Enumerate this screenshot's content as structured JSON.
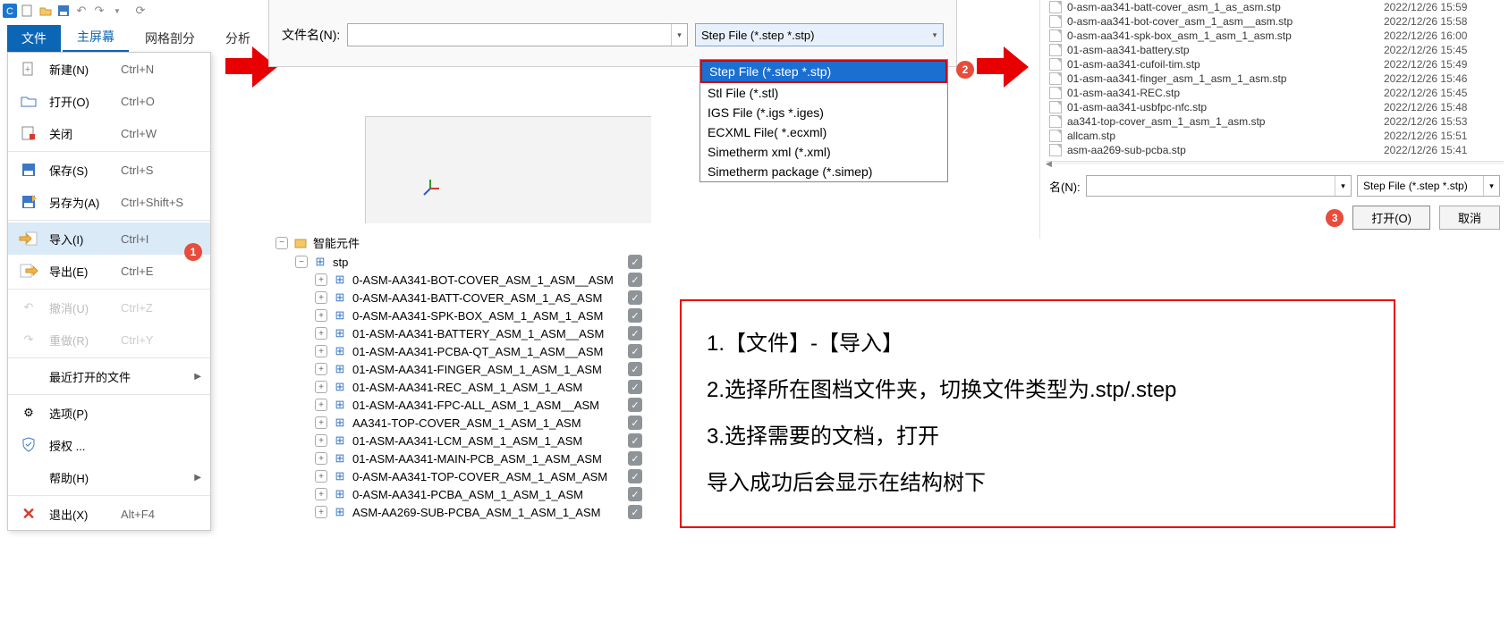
{
  "ribbon": {
    "file": "文件",
    "main": "主屏幕",
    "mesh": "网格剖分",
    "analysis": "分析"
  },
  "menu": {
    "new": {
      "label": "新建(N)",
      "shortcut": "Ctrl+N"
    },
    "open": {
      "label": "打开(O)",
      "shortcut": "Ctrl+O"
    },
    "close": {
      "label": "关闭",
      "shortcut": "Ctrl+W"
    },
    "save": {
      "label": "保存(S)",
      "shortcut": "Ctrl+S"
    },
    "saveas": {
      "label": "另存为(A)",
      "shortcut": "Ctrl+Shift+S"
    },
    "import": {
      "label": "导入(I)",
      "shortcut": "Ctrl+I"
    },
    "export": {
      "label": "导出(E)",
      "shortcut": "Ctrl+E"
    },
    "undo": {
      "label": "撤消(U)",
      "shortcut": "Ctrl+Z"
    },
    "redo": {
      "label": "重做(R)",
      "shortcut": "Ctrl+Y"
    },
    "recent": {
      "label": "最近打开的文件"
    },
    "options": {
      "label": "选项(P)"
    },
    "license": {
      "label": "授权 ..."
    },
    "help": {
      "label": "帮助(H)"
    },
    "exit": {
      "label": "退出(X)",
      "shortcut": "Alt+F4"
    }
  },
  "callouts": {
    "c1": "1",
    "c2": "2",
    "c3": "3"
  },
  "openDialog": {
    "filenameLabel": "文件名(N):",
    "typeSelected": "Step File (*.step *.stp)",
    "options": {
      "o0": "Step File (*.step *.stp)",
      "o1": "Stl File (*.stl)",
      "o2": "IGS File (*.igs *.iges)",
      "o3": "ECXML File( *.ecxml)",
      "o4": "Simetherm xml (*.xml)",
      "o5": "Simetherm package (*.simep)"
    }
  },
  "tree": {
    "root": "智能元件",
    "stp": "stp",
    "items": {
      "i0": "0-ASM-AA341-BOT-COVER_ASM_1_ASM__ASM",
      "i1": "0-ASM-AA341-BATT-COVER_ASM_1_AS_ASM",
      "i2": "0-ASM-AA341-SPK-BOX_ASM_1_ASM_1_ASM",
      "i3": "01-ASM-AA341-BATTERY_ASM_1_ASM__ASM",
      "i4": "01-ASM-AA341-PCBA-QT_ASM_1_ASM__ASM",
      "i5": "01-ASM-AA341-FINGER_ASM_1_ASM_1_ASM",
      "i6": "01-ASM-AA341-REC_ASM_1_ASM_1_ASM",
      "i7": "01-ASM-AA341-FPC-ALL_ASM_1_ASM__ASM",
      "i8": "AA341-TOP-COVER_ASM_1_ASM_1_ASM",
      "i9": "01-ASM-AA341-LCM_ASM_1_ASM_1_ASM",
      "i10": "01-ASM-AA341-MAIN-PCB_ASM_1_ASM_ASM",
      "i11": "0-ASM-AA341-TOP-COVER_ASM_1_ASM_ASM",
      "i12": "0-ASM-AA341-PCBA_ASM_1_ASM_1_ASM",
      "i13": "ASM-AA269-SUB-PCBA_ASM_1_ASM_1_ASM"
    }
  },
  "browser": {
    "files": {
      "f0": {
        "name": "0-asm-aa341-batt-cover_asm_1_as_asm.stp",
        "date": "2022/12/26 15:59"
      },
      "f1": {
        "name": "0-asm-aa341-bot-cover_asm_1_asm__asm.stp",
        "date": "2022/12/26 15:58"
      },
      "f2": {
        "name": "0-asm-aa341-spk-box_asm_1_asm_1_asm.stp",
        "date": "2022/12/26 16:00"
      },
      "f3": {
        "name": "01-asm-aa341-battery.stp",
        "date": "2022/12/26 15:45"
      },
      "f4": {
        "name": "01-asm-aa341-cufoil-tim.stp",
        "date": "2022/12/26 15:49"
      },
      "f5": {
        "name": "01-asm-aa341-finger_asm_1_asm_1_asm.stp",
        "date": "2022/12/26 15:46"
      },
      "f6": {
        "name": "01-asm-aa341-REC.stp",
        "date": "2022/12/26 15:45"
      },
      "f7": {
        "name": "01-asm-aa341-usbfpc-nfc.stp",
        "date": "2022/12/26 15:48"
      },
      "f8": {
        "name": "aa341-top-cover_asm_1_asm_1_asm.stp",
        "date": "2022/12/26 15:53"
      },
      "f9": {
        "name": "allcam.stp",
        "date": "2022/12/26 15:51"
      },
      "f10": {
        "name": "asm-aa269-sub-pcba.stp",
        "date": "2022/12/26 15:41"
      }
    },
    "nameLabel": "名(N):",
    "typeValue": "Step File (*.step *.stp)",
    "openBtn": "打开(O)",
    "cancelBtn": "取消"
  },
  "instructions": {
    "l1": "1.【文件】-【导入】",
    "l2": "2.选择所在图档文件夹，切换文件类型为.stp/.step",
    "l3": "3.选择需要的文档，打开",
    "l4": "导入成功后会显示在结构树下"
  }
}
